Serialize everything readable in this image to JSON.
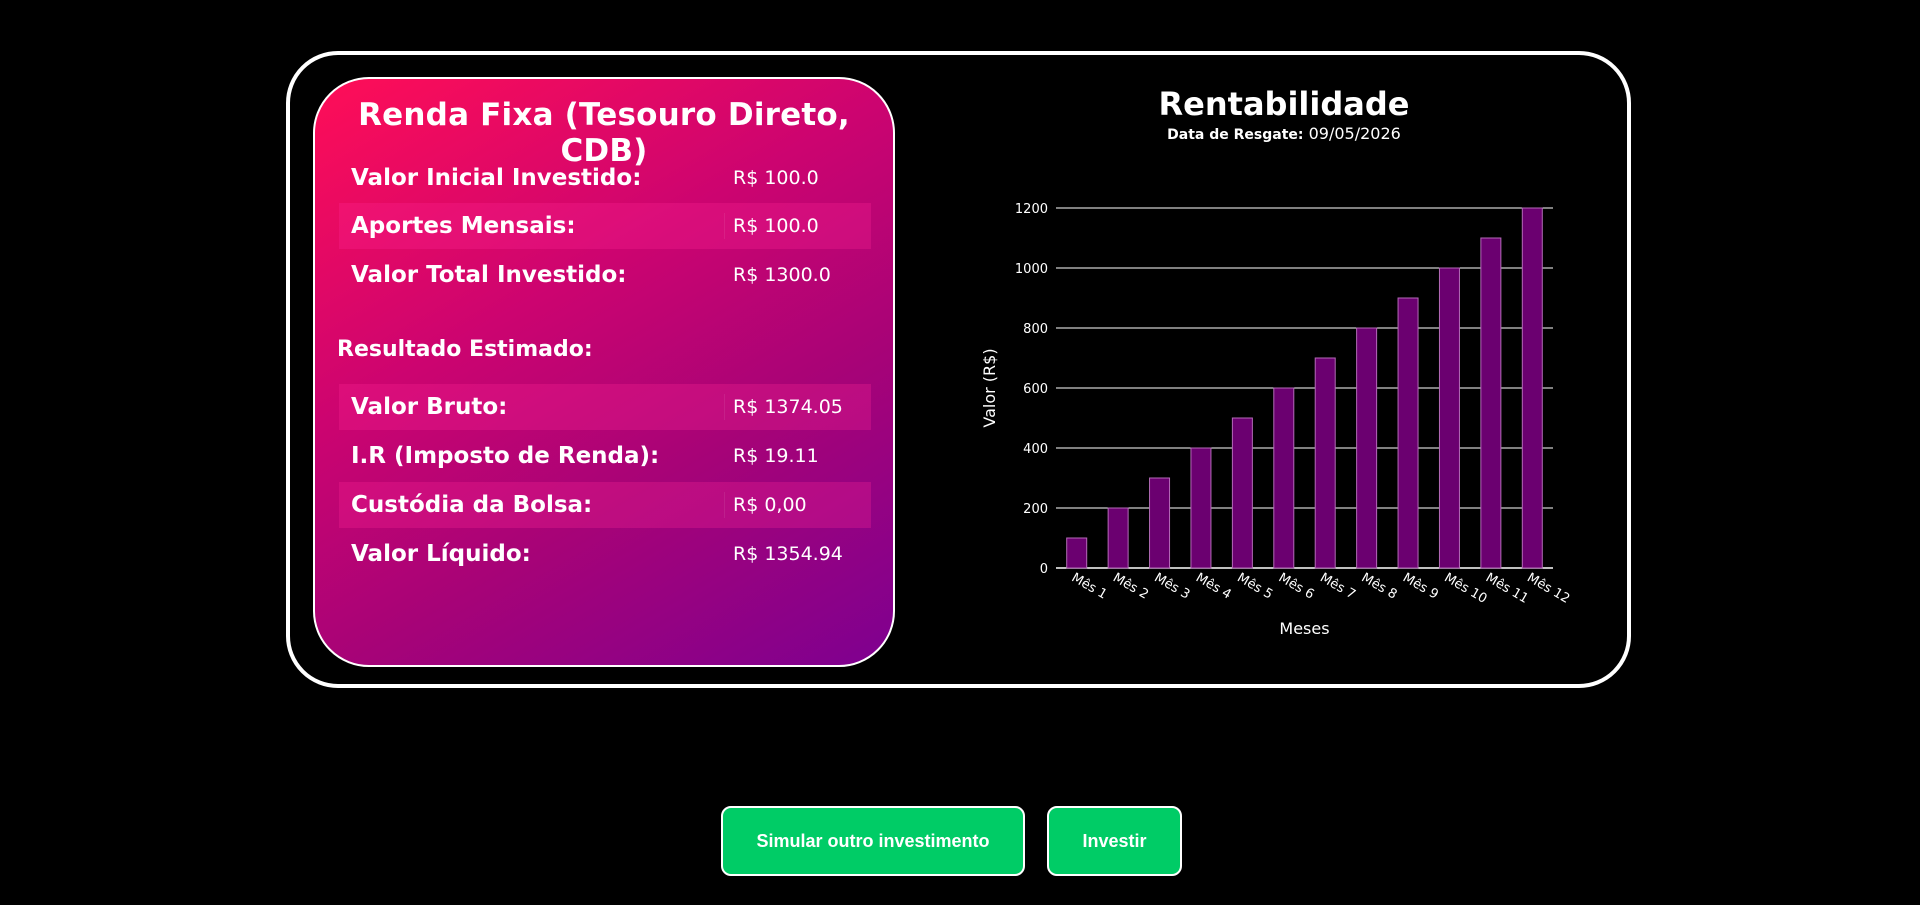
{
  "card": {
    "title": "Renda Fixa (Tesouro Direto, CDB)",
    "rows_top": [
      {
        "label": "Valor Inicial Investido:",
        "value": "R$ 100.0"
      },
      {
        "label": "Aportes Mensais:",
        "value": "R$ 100.0"
      },
      {
        "label": "Valor Total Investido:",
        "value": "R$ 1300.0"
      }
    ],
    "section_label": "Resultado Estimado:",
    "rows_result": [
      {
        "label": "Valor Bruto:",
        "value": "R$ 1374.05"
      },
      {
        "label": "I.R (Imposto de Renda):",
        "value": "R$ 19.11"
      },
      {
        "label": "Custódia da Bolsa:",
        "value": "R$ 0,00"
      },
      {
        "label": "Valor Líquido:",
        "value": "R$ 1354.94"
      }
    ]
  },
  "chart_header": {
    "title": "Rentabilidade",
    "subtitle_label": "Data de Resgate:",
    "subtitle_value": "09/05/2026"
  },
  "chart_data": {
    "type": "bar",
    "categories": [
      "Mês 1",
      "Mês 2",
      "Mês 3",
      "Mês 4",
      "Mês 5",
      "Mês 6",
      "Mês 7",
      "Mês 8",
      "Mês 9",
      "Mês 10",
      "Mês 11",
      "Mês 12"
    ],
    "values": [
      100,
      200,
      300,
      400,
      500,
      600,
      700,
      800,
      900,
      1000,
      1100,
      1200
    ],
    "xlabel": "Meses",
    "ylabel": "Valor (R$)",
    "ylim": [
      0,
      1200
    ],
    "yticks": [
      0,
      200,
      400,
      600,
      800,
      1000,
      1200
    ],
    "grid": true,
    "bar_color": "#6b0070",
    "bar_edge_color": "#b46ab8"
  },
  "buttons": {
    "simulate_label": "Simular outro investimento",
    "invest_label": "Investir"
  }
}
